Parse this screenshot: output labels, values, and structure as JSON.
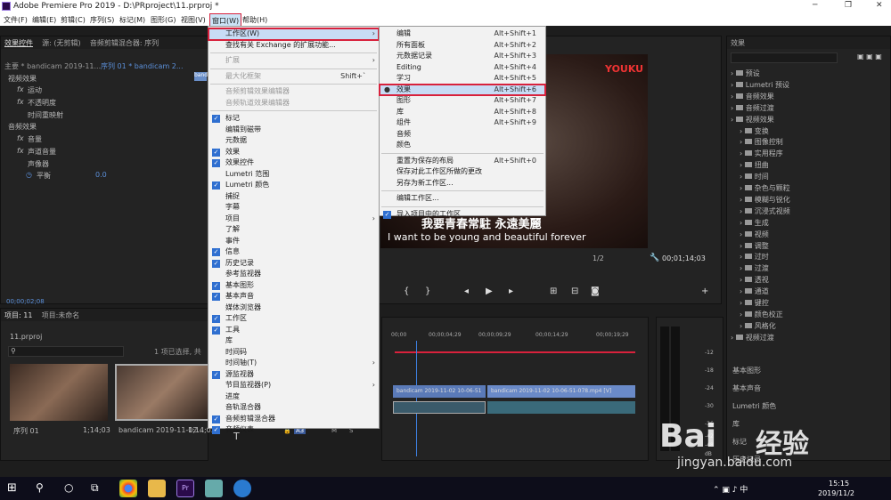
{
  "app_title": "Adobe Premiere Pro 2019 - D:\\PRproject\\11.prproj *",
  "menus": [
    "文件(F)",
    "编辑(E)",
    "剪辑(C)",
    "序列(S)",
    "标记(M)",
    "图形(G)",
    "视图(V)",
    "窗口(W)",
    "帮助(H)"
  ],
  "left_tabs": {
    "effect_controls": "效果控件",
    "source": "源: (无剪辑)",
    "audio_mixer": "音频剪辑混合器: 序列"
  },
  "left_seq": {
    "master": "主要 * bandicam 2019-11...",
    "seq": "序列 01 * bandicam 2..."
  },
  "clip_label": "bandi",
  "video_effects": {
    "header": "视频效果",
    "motion": "运动",
    "opacity": "不透明度",
    "time_remap": "时间重映射"
  },
  "audio_effects": {
    "header": "音频效果",
    "volume": "音量",
    "channel_volume": "声道音量",
    "panner": "声像器",
    "balance": "平衡",
    "balance_val": "0.0"
  },
  "ec_timecode": "00;00;02;08",
  "project": {
    "tab": "项目: 11",
    "tab2": "项目:未命名",
    "file": "11.prproj",
    "status": "1 项已选择, 共",
    "items": [
      {
        "name": "序列 01",
        "dur": "1;14;03"
      },
      {
        "name": "bandicam 2019-11-02...",
        "dur": "1;14;03"
      }
    ]
  },
  "program": {
    "subtitle_cn": "我要青春常駐 永遠美麗",
    "subtitle_en": "I want to be young and beautiful forever",
    "fraction": "1/2",
    "timecode": "00;01;14;03",
    "logo": "YOUKU"
  },
  "timeline": {
    "ticks": [
      "00;00",
      "00;00;04;29",
      "00;00;09;29",
      "00;00;14;29",
      "00;00;19;29"
    ],
    "clip1": "bandicam 2019-11-02 10-06-51",
    "clip2": "bandicam 2019-11-02 10-06-51-078.mp4 [V]",
    "track_buttons": [
      "A3",
      "M",
      "S"
    ]
  },
  "meter_db": [
    "-12",
    "-18",
    "-24",
    "-30",
    "-36",
    "-42",
    "-48",
    "dB"
  ],
  "effects_panel": {
    "title": "效果",
    "tree": [
      "预设",
      "Lumetri 预设",
      "音频效果",
      "音频过渡",
      "视频效果",
      "变换",
      "图像控制",
      "实用程序",
      "扭曲",
      "时间",
      "杂色与颗粒",
      "模糊与锐化",
      "沉浸式视频",
      "生成",
      "视频",
      "调整",
      "过时",
      "过渡",
      "透视",
      "通道",
      "键控",
      "颜色校正",
      "风格化",
      "视频过渡"
    ],
    "extra": [
      "基本图形",
      "基本声音",
      "Lumetri 颜色",
      "库",
      "标记",
      "历史记录"
    ]
  },
  "window_menu": [
    {
      "label": "工作区(W)",
      "type": "sub",
      "sel": true,
      "hl": true
    },
    {
      "label": "查找有关 Exchange 的扩展功能..."
    },
    {
      "sep": true
    },
    {
      "label": "扩展",
      "type": "sub",
      "dis": true
    },
    {
      "sep": true
    },
    {
      "label": "最大化框架",
      "sc": "Shift+`",
      "dis": true
    },
    {
      "sep": true
    },
    {
      "label": "音频剪辑效果编辑器",
      "dis": true
    },
    {
      "label": "音频轨道效果编辑器",
      "dis": true
    },
    {
      "sep": true
    },
    {
      "label": "标记",
      "chk": true
    },
    {
      "label": "编辑到磁带"
    },
    {
      "label": "元数据"
    },
    {
      "label": "效果",
      "chk": true
    },
    {
      "label": "效果控件",
      "chk": true
    },
    {
      "label": "Lumetri 范围"
    },
    {
      "label": "Lumetri 颜色",
      "chk": true
    },
    {
      "label": "捕捉"
    },
    {
      "label": "字幕"
    },
    {
      "label": "项目",
      "type": "sub"
    },
    {
      "label": "了解"
    },
    {
      "label": "事件"
    },
    {
      "label": "信息",
      "chk": true
    },
    {
      "label": "历史记录",
      "chk": true
    },
    {
      "label": "参考监视器"
    },
    {
      "label": "基本图形",
      "chk": true
    },
    {
      "label": "基本声音",
      "chk": true
    },
    {
      "label": "媒体浏览器"
    },
    {
      "label": "工作区",
      "chk": true
    },
    {
      "label": "工具",
      "chk": true
    },
    {
      "label": "库"
    },
    {
      "label": "时间码"
    },
    {
      "label": "时间轴(T)",
      "type": "sub"
    },
    {
      "label": "源监视器",
      "chk": true
    },
    {
      "label": "节目监视器(P)",
      "type": "sub"
    },
    {
      "label": "进度"
    },
    {
      "label": "音轨混合器"
    },
    {
      "label": "音频剪辑混合器",
      "chk": true
    },
    {
      "label": "音频仪表",
      "chk": true
    }
  ],
  "workspace_menu": [
    {
      "label": "编辑",
      "sc": "Alt+Shift+1"
    },
    {
      "label": "所有面板",
      "sc": "Alt+Shift+2"
    },
    {
      "label": "元数据记录",
      "sc": "Alt+Shift+3"
    },
    {
      "label": "Editing",
      "sc": "Alt+Shift+4"
    },
    {
      "label": "学习",
      "sc": "Alt+Shift+5"
    },
    {
      "label": "效果",
      "sc": "Alt+Shift+6",
      "bullet": true,
      "hl": true
    },
    {
      "label": "图形",
      "sc": "Alt+Shift+7"
    },
    {
      "label": "库",
      "sc": "Alt+Shift+8"
    },
    {
      "label": "组件",
      "sc": "Alt+Shift+9"
    },
    {
      "label": "音频"
    },
    {
      "label": "颜色"
    },
    {
      "sep": true
    },
    {
      "label": "重置为保存的布局",
      "sc": "Alt+Shift+0"
    },
    {
      "label": "保存对此工作区所做的更改"
    },
    {
      "label": "另存为新工作区..."
    },
    {
      "sep": true
    },
    {
      "label": "编辑工作区..."
    },
    {
      "sep": true
    },
    {
      "label": "导入项目中的工作区",
      "chk": true
    }
  ],
  "clock": {
    "time": "15:15",
    "date": "2019/11/2"
  },
  "watermark": {
    "brand": "Bai",
    "brand2": "经验",
    "url": "jingyan.baidu.com"
  },
  "colors": {
    "accent": "#2f6fd0",
    "highlight": "#d8213c",
    "panel": "#232323",
    "blue_link": "#5b8fd9"
  }
}
